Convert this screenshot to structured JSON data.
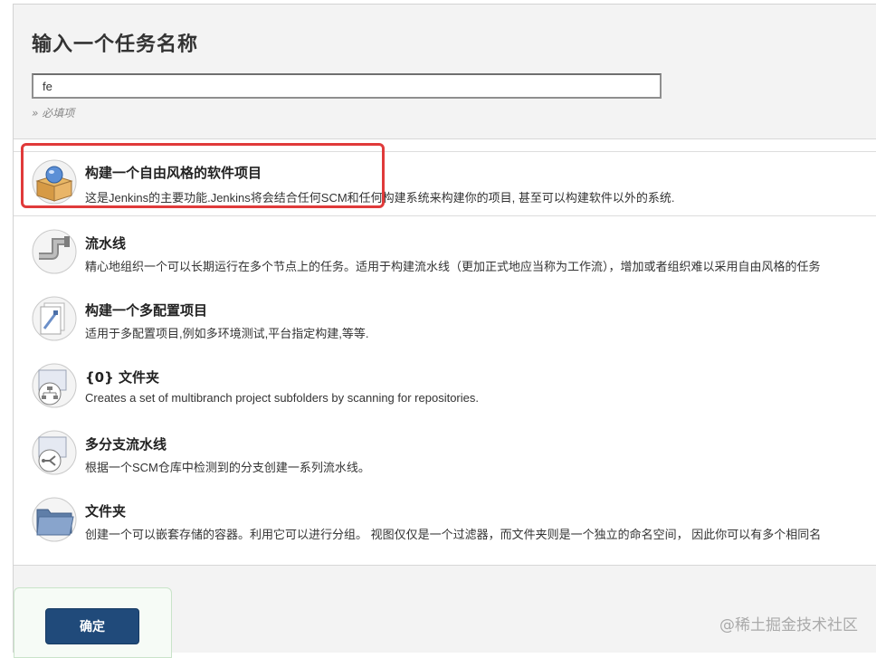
{
  "form": {
    "title": "输入一个任务名称",
    "name_value": "fe",
    "required_hint": "» 必填项"
  },
  "items": [
    {
      "icon": "freestyle-project-icon",
      "title": "构建一个自由风格的软件项目",
      "desc": "这是Jenkins的主要功能.Jenkins将会结合任何SCM和任何构建系统来构建你的项目, 甚至可以构建软件以外的系统."
    },
    {
      "icon": "pipeline-icon",
      "title": "流水线",
      "desc": "精心地组织一个可以长期运行在多个节点上的任务。适用于构建流水线（更加正式地应当称为工作流），增加或者组织难以采用自由风格的任务"
    },
    {
      "icon": "multi-config-project-icon",
      "title": "构建一个多配置项目",
      "desc": "适用于多配置项目,例如多环境测试,平台指定构建,等等."
    },
    {
      "icon": "organization-folder-icon",
      "title": "{0} 文件夹",
      "desc": "Creates a set of multibranch project subfolders by scanning for repositories."
    },
    {
      "icon": "multibranch-pipeline-icon",
      "title": "多分支流水线",
      "desc": "根据一个SCM仓库中检测到的分支创建一系列流水线。"
    },
    {
      "icon": "folder-icon",
      "title": "文件夹",
      "desc": "创建一个可以嵌套存储的容器。利用它可以进行分组。 视图仅仅是一个过滤器，而文件夹则是一个独立的命名空间， 因此你可以有多个相同名"
    }
  ],
  "footer": {
    "ok_label": "确定"
  },
  "watermark": "@稀土掘金技术社区",
  "colors": {
    "ok_button": "#204a7a",
    "highlight": "#e03a3a"
  }
}
